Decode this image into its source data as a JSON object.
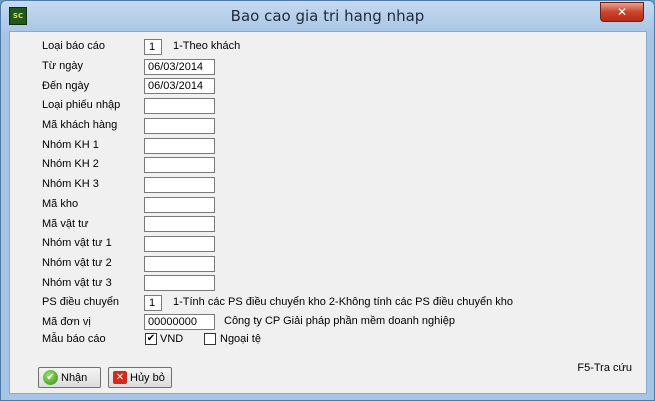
{
  "window": {
    "title": "Bao cao gia tri hang nhap",
    "icon_text": "SC",
    "close_symbol": "✕"
  },
  "form": {
    "loai_bao_cao": {
      "label": "Loại báo cáo",
      "value": "1",
      "note": "1-Theo khách"
    },
    "tu_ngay": {
      "label": "Từ ngày",
      "value": "06/03/2014"
    },
    "den_ngay": {
      "label": "Đến ngày",
      "value": "06/03/2014"
    },
    "loai_phieu_nhap": {
      "label": "Loại phiếu nhập",
      "value": ""
    },
    "ma_khach_hang": {
      "label": "Mã khách hàng",
      "value": ""
    },
    "nhom_kh_1": {
      "label": "Nhóm KH 1",
      "value": ""
    },
    "nhom_kh_2": {
      "label": "Nhóm KH 2",
      "value": ""
    },
    "nhom_kh_3": {
      "label": "Nhóm KH 3",
      "value": ""
    },
    "ma_kho": {
      "label": "Mã kho",
      "value": ""
    },
    "ma_vat_tu": {
      "label": "Mã vật tư",
      "value": ""
    },
    "nhom_vat_tu_1": {
      "label": "Nhóm vật tư 1",
      "value": ""
    },
    "nhom_vat_tu_2": {
      "label": "Nhóm vật tư 2",
      "value": ""
    },
    "nhom_vat_tu_3": {
      "label": "Nhóm vật tư 3",
      "value": ""
    },
    "ps_dieu_chuyen": {
      "label": "PS điều chuyển",
      "value": "1",
      "note": "1-Tính các PS điều chuyển kho 2-Không tính các PS điều chuyển kho"
    },
    "ma_don_vi": {
      "label": "Mã đơn vị",
      "value": "00000000",
      "note": "Công ty CP Giải pháp phần mềm doanh nghiệp"
    },
    "mau_bao_cao": {
      "label": "Mẫu báo cáo",
      "options": [
        {
          "label": "VND",
          "checked": true
        },
        {
          "label": "Ngoại tệ",
          "checked": false
        }
      ],
      "check_mark": "✔"
    }
  },
  "buttons": {
    "ok": {
      "label": "Nhận",
      "icon": "check-icon",
      "glyph": "✔"
    },
    "cancel": {
      "label": "Hủy bỏ",
      "icon": "x-icon",
      "glyph": "✕"
    }
  },
  "hint": "F5-Tra cứu",
  "colors": {
    "title_bar": "#a6c4e4",
    "client": "#f0f0f0",
    "close": "#c8452e"
  }
}
